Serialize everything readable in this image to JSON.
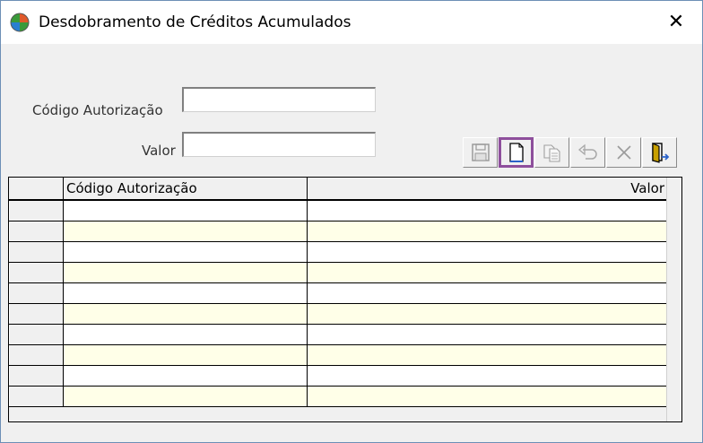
{
  "window": {
    "title": "Desdobramento de Créditos Acumulados",
    "close_glyph": "✕"
  },
  "form": {
    "codigo_label": "Código Autorização",
    "codigo_value": "",
    "valor_label": "Valor",
    "valor_value": ""
  },
  "toolbar": {
    "buttons": [
      {
        "name": "save-button",
        "icon": "floppy-disk-icon",
        "enabled": false
      },
      {
        "name": "new-button",
        "icon": "new-document-icon",
        "enabled": true,
        "focused": true
      },
      {
        "name": "copy-button",
        "icon": "copy-document-icon",
        "enabled": false
      },
      {
        "name": "undo-button",
        "icon": "undo-icon",
        "enabled": false
      },
      {
        "name": "delete-button",
        "icon": "x-delete-icon",
        "enabled": false
      },
      {
        "name": "exit-button",
        "icon": "exit-door-icon",
        "enabled": true
      }
    ]
  },
  "grid": {
    "columns": [
      "Código Autorização",
      "Valor"
    ],
    "row_count": 10
  },
  "colors": {
    "row_even": "#ffffe8",
    "row_odd": "#ffffff",
    "focus_outline": "#8e4f9c"
  }
}
